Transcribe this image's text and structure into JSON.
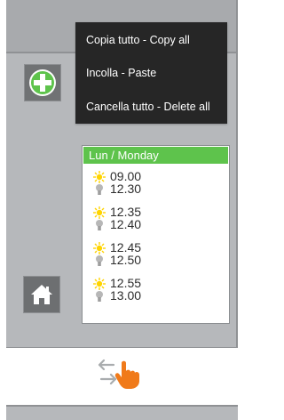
{
  "menu": {
    "items": [
      "Copia tutto - Copy all",
      "Incolla - Paste",
      "Cancella tutto - Delete all"
    ]
  },
  "schedule": {
    "day": "Lun / Monday",
    "slots": [
      {
        "on": "09.00",
        "off": "12.30"
      },
      {
        "on": "12.35",
        "off": "12.40"
      },
      {
        "on": "12.45",
        "off": "12.50"
      },
      {
        "on": "12.55",
        "off": "13.00"
      }
    ]
  },
  "icons": {
    "add": "plus-circle-icon",
    "home": "home-icon",
    "on": "sun-icon",
    "off": "bulb-icon",
    "swipe": "swipe-hand-icon"
  },
  "colors": {
    "accent_green": "#5ec34c",
    "panel_gray": "#b6b8bb",
    "menu_bg": "#262626",
    "sun_yellow": "#ffd400",
    "hand_orange": "#f07a1a"
  }
}
